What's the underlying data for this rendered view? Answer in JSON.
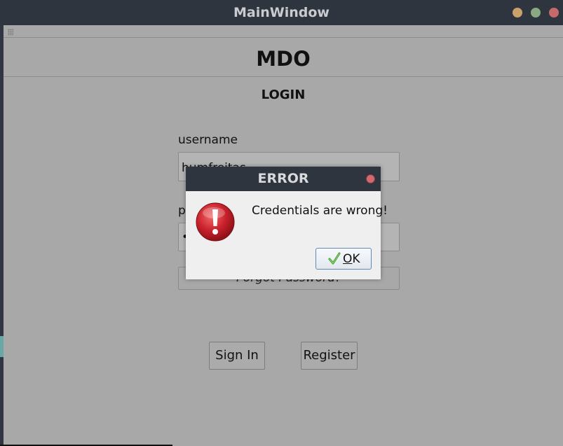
{
  "window": {
    "title": "MainWindow",
    "controls": {
      "minimize_color": "#c9a26b",
      "maximize_color": "#8aa982",
      "close_color": "#c46a6a"
    }
  },
  "app": {
    "title": "MDO",
    "section": "LOGIN"
  },
  "form": {
    "username_label": "username",
    "username_value": "humfreitas",
    "password_label": "password",
    "password_value": "••••••••",
    "forgot_label": "Forgot Password?",
    "signin_label": "Sign In",
    "register_label": "Register"
  },
  "dialog": {
    "title": "ERROR",
    "message": "Credentials are wrong!",
    "ok_mnemonic": "O",
    "ok_rest": "K",
    "icon": "error-icon"
  },
  "colors": {
    "titlebar_bg": "#2f353e",
    "content_bg": "#a8a8a8",
    "dialog_body_bg": "#efefef",
    "error_red": "#c8202a"
  }
}
